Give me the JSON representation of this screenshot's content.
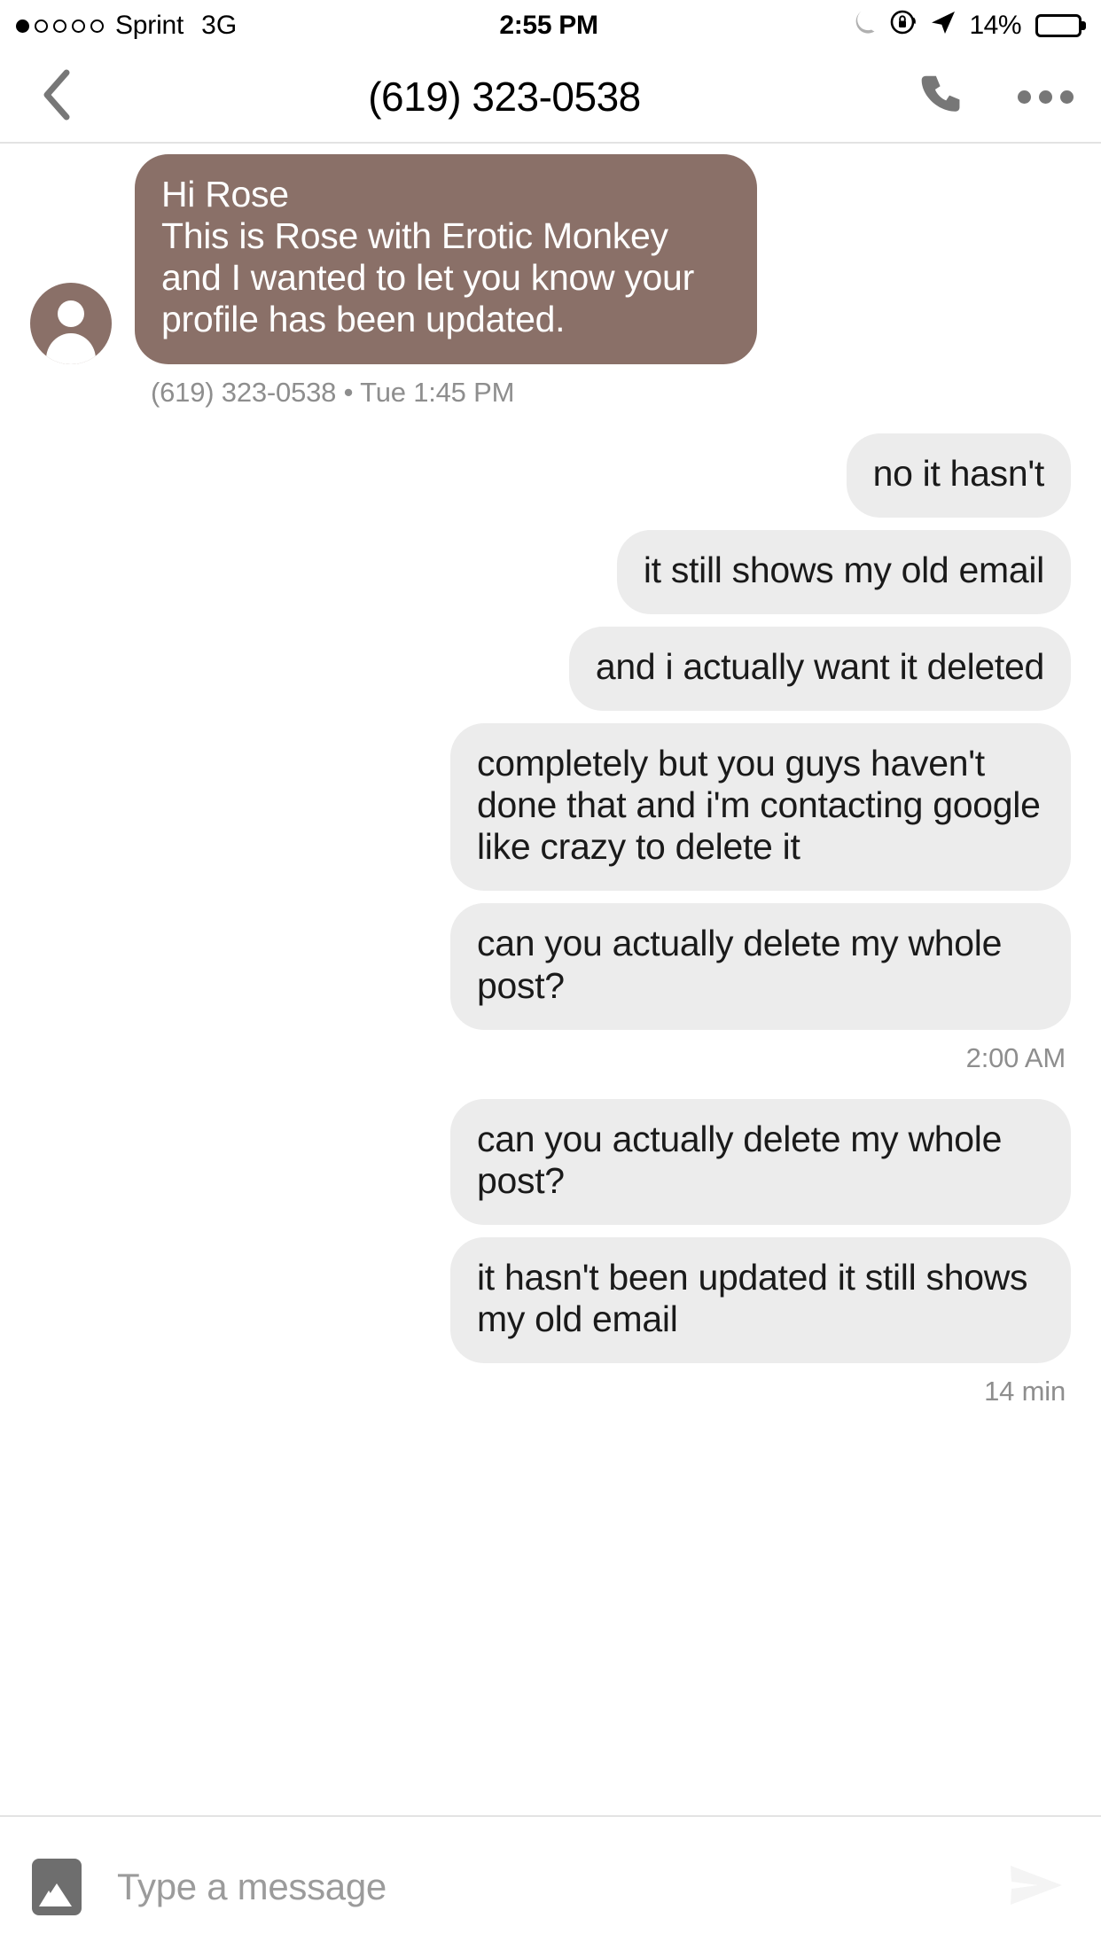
{
  "status_bar": {
    "carrier": "Sprint",
    "network": "3G",
    "time": "2:55 PM",
    "battery_percent": "14%",
    "battery_level": 14,
    "signal_bars_filled": 1,
    "signal_bars_total": 5,
    "icons": [
      "moon-icon",
      "rotation-lock-icon",
      "location-arrow-icon",
      "battery-icon"
    ],
    "battery_color": "#ff3b30"
  },
  "nav_bar": {
    "back_icon": "chevron-left-icon",
    "title": "(619) 323-0538",
    "call_icon": "phone-icon",
    "overflow_icon": "more-options-icon"
  },
  "conversation": {
    "accent_color": "#8a7068",
    "outgoing_bubble_color": "#ececec",
    "messages": [
      {
        "id": "m1",
        "direction": "incoming",
        "avatar": true,
        "text": "Hi Rose\nThis is Rose with Erotic Monkey and I wanted to let you know your profile has been updated.",
        "meta": "(619) 323-0538 • Tue 1:45 PM",
        "meta_align": "left"
      },
      {
        "id": "m2",
        "direction": "outgoing",
        "avatar": false,
        "text": "no it hasn't",
        "meta": "",
        "meta_align": "right"
      },
      {
        "id": "m3",
        "direction": "outgoing",
        "avatar": false,
        "text": "it still shows my old email",
        "meta": "",
        "meta_align": "right"
      },
      {
        "id": "m4",
        "direction": "outgoing",
        "avatar": false,
        "text": "and i actually want it deleted",
        "meta": "",
        "meta_align": "right"
      },
      {
        "id": "m5",
        "direction": "outgoing",
        "avatar": false,
        "text": "completely but you guys haven't done that and i'm contacting google like crazy to delete it",
        "meta": "",
        "meta_align": "right"
      },
      {
        "id": "m6",
        "direction": "outgoing",
        "avatar": false,
        "text": "can you actually delete my whole post?",
        "meta": "2:00 AM",
        "meta_align": "right"
      },
      {
        "id": "m7",
        "direction": "outgoing",
        "avatar": false,
        "text": "can you actually delete my whole post?",
        "meta": "",
        "meta_align": "right"
      },
      {
        "id": "m8",
        "direction": "outgoing",
        "avatar": false,
        "text": "it hasn't been updated it still shows my old email",
        "meta": "14 min",
        "meta_align": "right"
      }
    ]
  },
  "composer": {
    "attach_icon": "image-attachment-icon",
    "input_value": "",
    "input_placeholder": "Type a message",
    "send_icon": "send-icon"
  }
}
